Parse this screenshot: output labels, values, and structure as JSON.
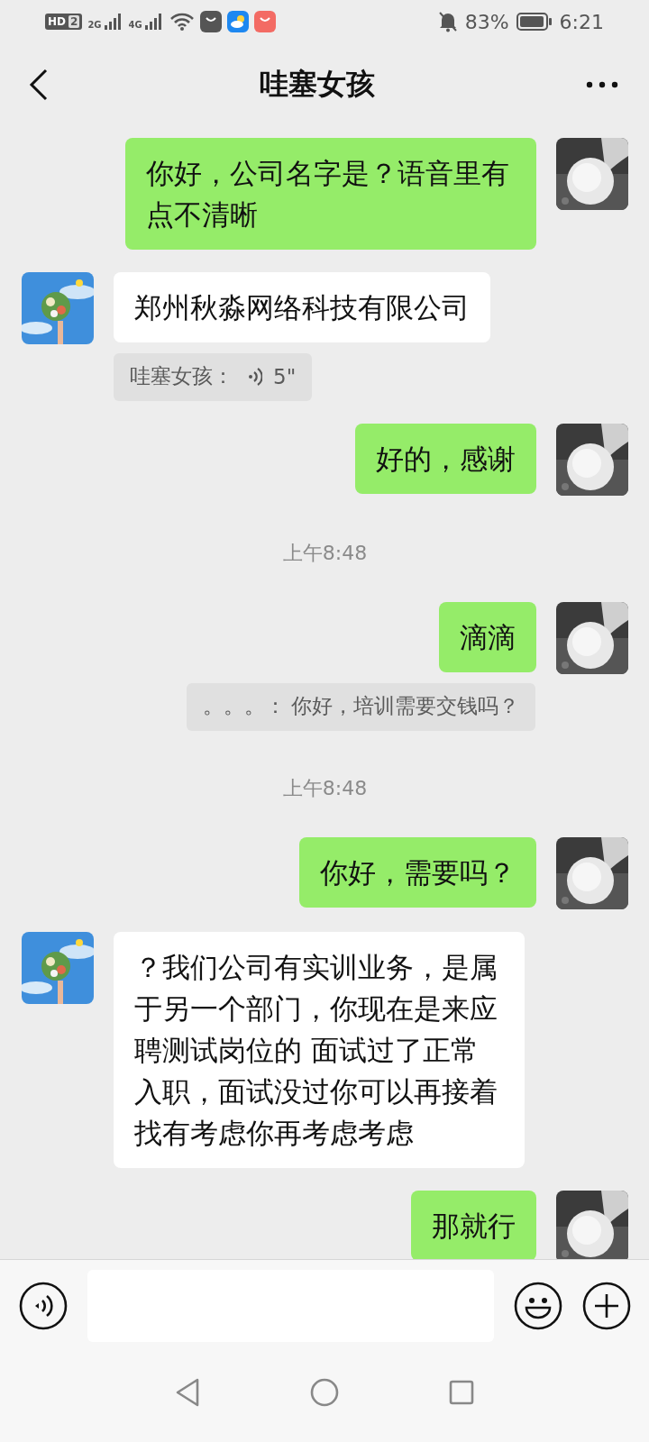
{
  "status_bar": {
    "hd_label": "HD",
    "sim_label": "2",
    "network_labels": [
      "2G",
      "4G"
    ],
    "battery": "83%",
    "time": "6:21"
  },
  "header": {
    "title": "哇塞女孩"
  },
  "messages": [
    {
      "kind": "sent",
      "text": "你好，公司名字是？语音里有点不清晰"
    },
    {
      "kind": "received",
      "text": "郑州秋淼网络科技有限公司"
    },
    {
      "kind": "quote_left",
      "voice": true,
      "sender": "哇塞女孩：",
      "text": "5\""
    },
    {
      "kind": "sent",
      "text": "好的，感谢"
    },
    {
      "kind": "time",
      "text": "上午8:48"
    },
    {
      "kind": "sent",
      "text": "滴滴"
    },
    {
      "kind": "quote_right",
      "voice": false,
      "sender": "。。。：",
      "text": "你好，培训需要交钱吗？"
    },
    {
      "kind": "time",
      "text": "上午8:48"
    },
    {
      "kind": "sent",
      "text": "你好，需要吗？"
    },
    {
      "kind": "received",
      "text": "？我们公司有实训业务，是属于另一个部门，你现在是来应聘测试岗位的 面试过了正常入职，面试没过你可以再接着找有考虑你再考虑考虑"
    },
    {
      "kind": "sent",
      "text": "那就行"
    }
  ]
}
